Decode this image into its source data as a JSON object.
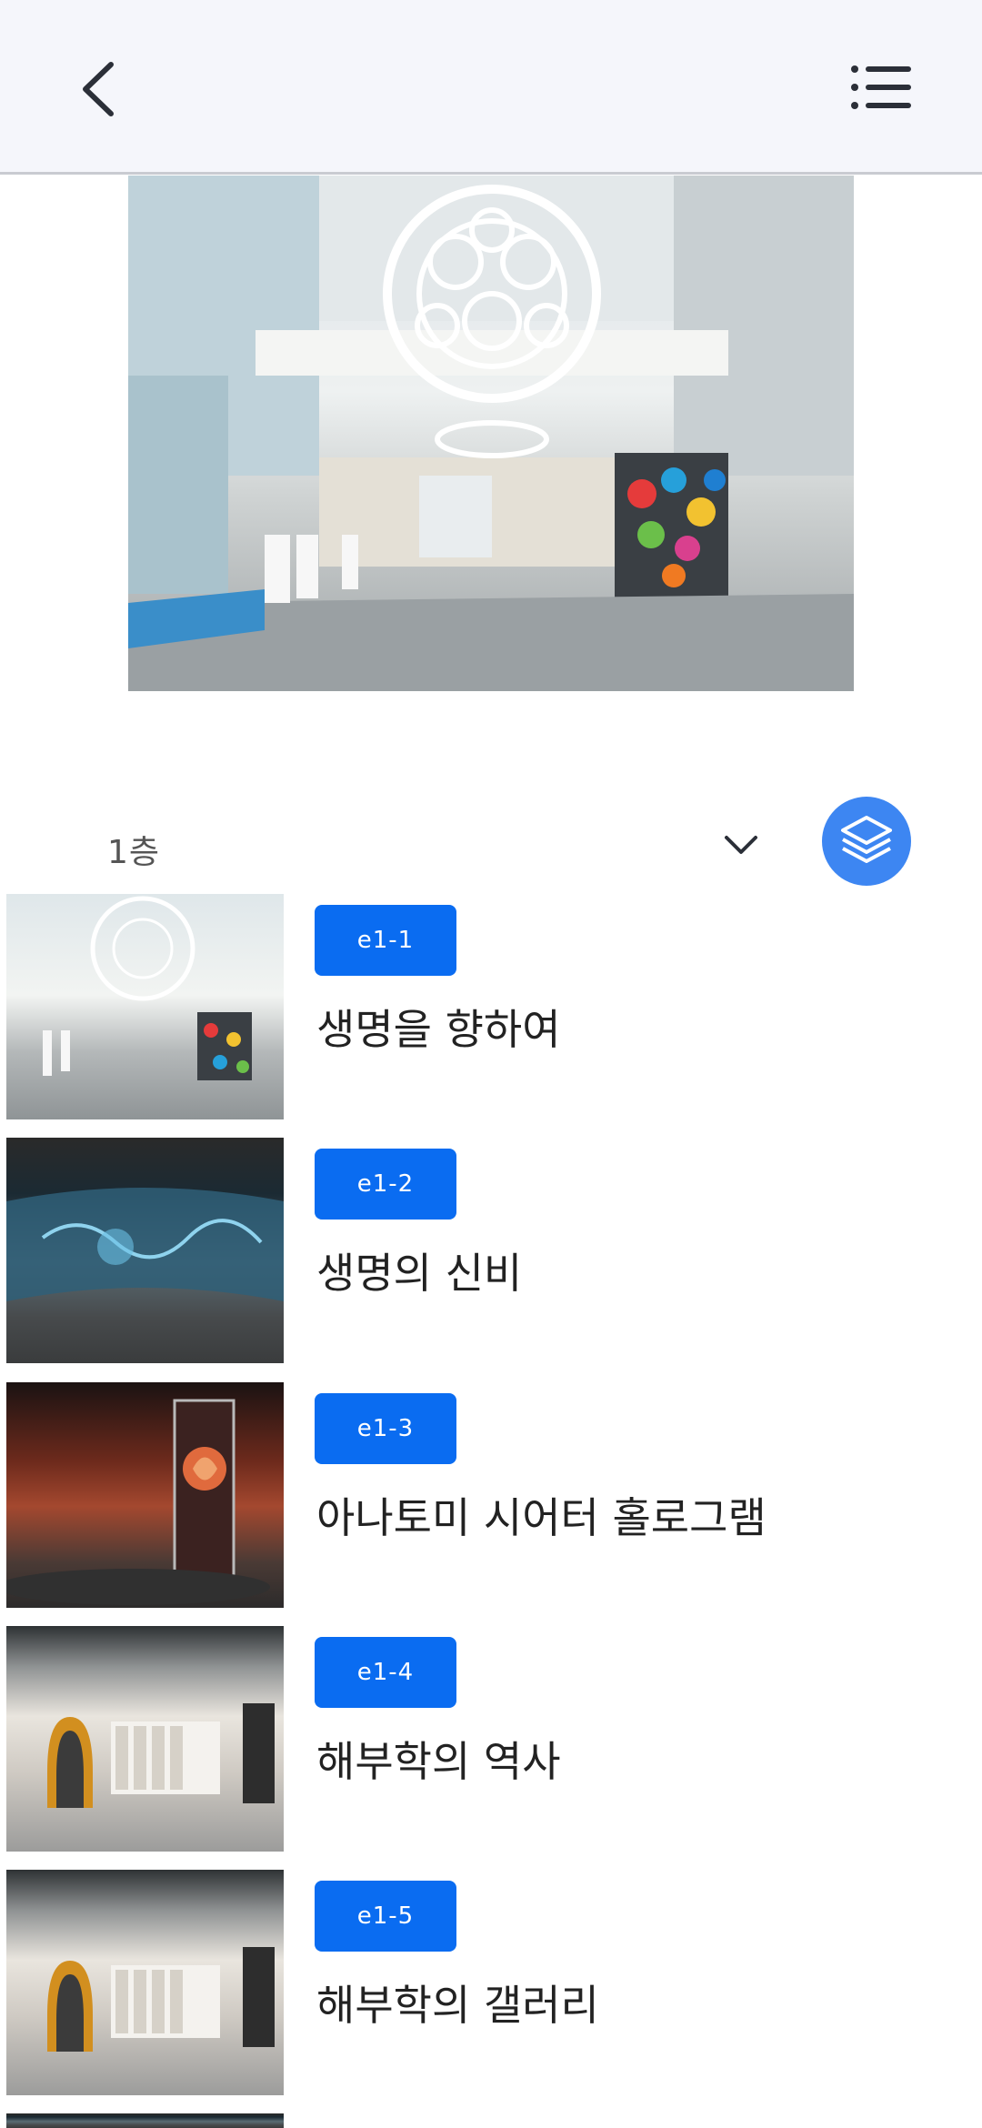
{
  "header": {
    "back_icon": "chevron-left-icon",
    "menu_icon": "list-icon"
  },
  "hero": {
    "image": "lobby-interior-photo"
  },
  "floor": {
    "selected": "1층",
    "dropdown_icon": "chevron-down-icon",
    "layer_icon": "layers-icon",
    "accent_color": "#3d86f2"
  },
  "exhibits": [
    {
      "code": "e1-1",
      "title": "생명을 향하여",
      "thumb": "lobby"
    },
    {
      "code": "e1-2",
      "title": "생명의 신비",
      "thumb": "dark-theater"
    },
    {
      "code": "e1-3",
      "title": "아나토미 시어터 홀로그램",
      "thumb": "red-hologram"
    },
    {
      "code": "e1-4",
      "title": "해부학의 역사",
      "thumb": "gallery"
    },
    {
      "code": "e1-5",
      "title": "해부학의 갤러리",
      "thumb": "gallery"
    }
  ],
  "badge_color": "#0a6cf1"
}
